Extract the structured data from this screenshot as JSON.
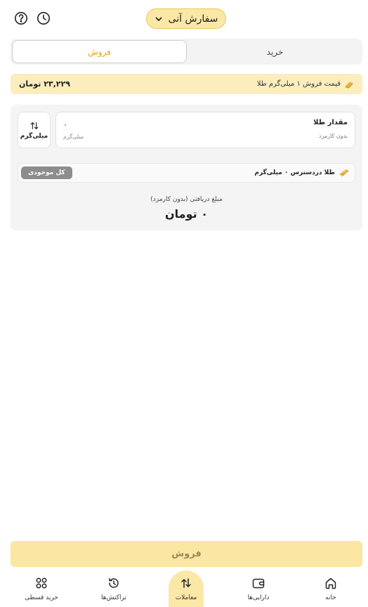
{
  "header": {
    "order_type": "سفارش آنی",
    "icons": [
      "help-icon",
      "history-icon",
      "chevron-down-icon"
    ]
  },
  "tabs": {
    "buy": "خرید",
    "sell": "فروش",
    "active": "sell"
  },
  "price": {
    "label": "قیمت فروش ۱ میلی‌گرم طلا",
    "value": "۲۳,۲۲۹ تومان"
  },
  "amount": {
    "title": "مقدار طلا",
    "subtitle": "بدون کارمزد",
    "value": "۰",
    "unit": "میلی‌گرم",
    "toggle_label": "میلی‌گرم"
  },
  "available": {
    "label": "طلا دردسترس ۰ میلی‌گرم",
    "all_button": "کل موجودی"
  },
  "receive": {
    "label": "مبلغ دریافتی (بدون کارمزد)",
    "value": "۰ تومان"
  },
  "actions": {
    "sell": "فروش"
  },
  "nav": {
    "items": [
      {
        "label": "خانه",
        "icon": "home-icon"
      },
      {
        "label": "دارایی‌ها",
        "icon": "wallet-icon"
      },
      {
        "label": "معاملات",
        "icon": "trade-icon",
        "active": true
      },
      {
        "label": "تراکنش‌ها",
        "icon": "transactions-icon"
      },
      {
        "label": "خرید قسطی",
        "icon": "grid-icon"
      }
    ]
  },
  "colors": {
    "accent": "#fbe8a6",
    "accent_text": "#e3a717",
    "price_bg": "#fbedbd",
    "card_bg": "#f4f4f4"
  }
}
